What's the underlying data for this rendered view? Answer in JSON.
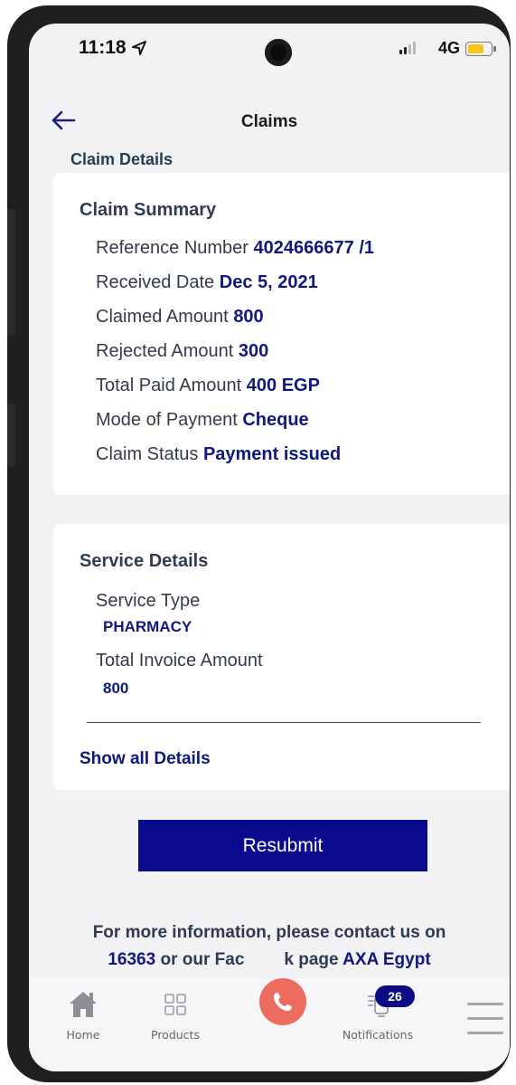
{
  "status_bar": {
    "time": "11:18",
    "network": "4G",
    "icons": [
      "location-arrow-icon",
      "camera-icon",
      "signal-icon",
      "battery-icon"
    ]
  },
  "header": {
    "title": "Claims",
    "back_icon": "arrow-left-icon"
  },
  "page": {
    "subtitle": "Claim Details"
  },
  "claim_summary": {
    "title": "Claim Summary",
    "rows": [
      {
        "label": "Reference Number",
        "value": "4024666677 /1"
      },
      {
        "label": "Received Date",
        "value": "Dec 5, 2021"
      },
      {
        "label": "Claimed Amount",
        "value": "800"
      },
      {
        "label": "Rejected Amount",
        "value": "300"
      },
      {
        "label": "Total Paid Amount",
        "value": "400 EGP"
      },
      {
        "label": "Mode of Payment",
        "value": "Cheque"
      },
      {
        "label": "Claim Status",
        "value": "Payment issued"
      }
    ]
  },
  "service_details": {
    "title": "Service Details",
    "items": [
      {
        "label": "Service Type",
        "value": "PHARMACY"
      },
      {
        "label": "Total Invoice Amount",
        "value": "800"
      }
    ],
    "show_all_label": "Show all Details"
  },
  "actions": {
    "resubmit_label": "Resubmit"
  },
  "contact": {
    "line1": "For more information, please contact us on",
    "phone": "16363",
    "middle": "or our Fac",
    "middle_end": "k page",
    "page_name": "AXA Egypt"
  },
  "bottom_nav": {
    "items": [
      {
        "label": "Home",
        "icon": "home-icon"
      },
      {
        "label": "Products",
        "icon": "grid-icon"
      },
      {
        "label": "Notifications",
        "icon": "bell-icon"
      }
    ],
    "notification_count": "26",
    "call_icon": "phone-icon",
    "menu_icon": "hamburger-menu-icon"
  },
  "colors": {
    "accent": "#0a0a8f",
    "value_text": "#10177e",
    "call_button": "#ec6d60",
    "background": "#f2f2f4"
  }
}
